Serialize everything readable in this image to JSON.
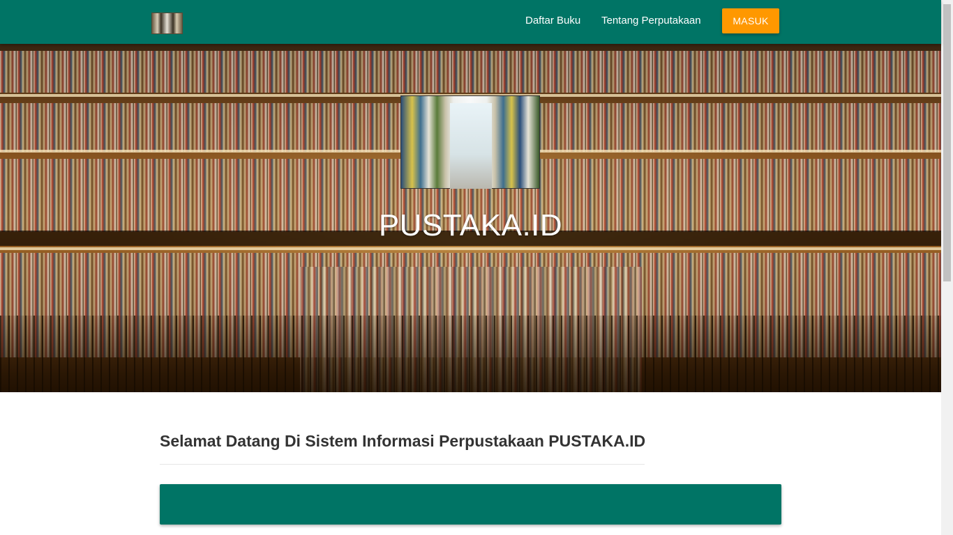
{
  "navbar": {
    "links": [
      {
        "label": "Daftar Buku"
      },
      {
        "label": "Tentang Perputakaan"
      }
    ],
    "login_label": "MASUK",
    "color": "#007465",
    "button_color": "#ff9800"
  },
  "hero": {
    "title": "PUSTAKA.ID"
  },
  "content": {
    "welcome": "Selamat Datang Di Sistem Informasi Perpustakaan PUSTAKA.ID",
    "panel_color": "#007465"
  }
}
